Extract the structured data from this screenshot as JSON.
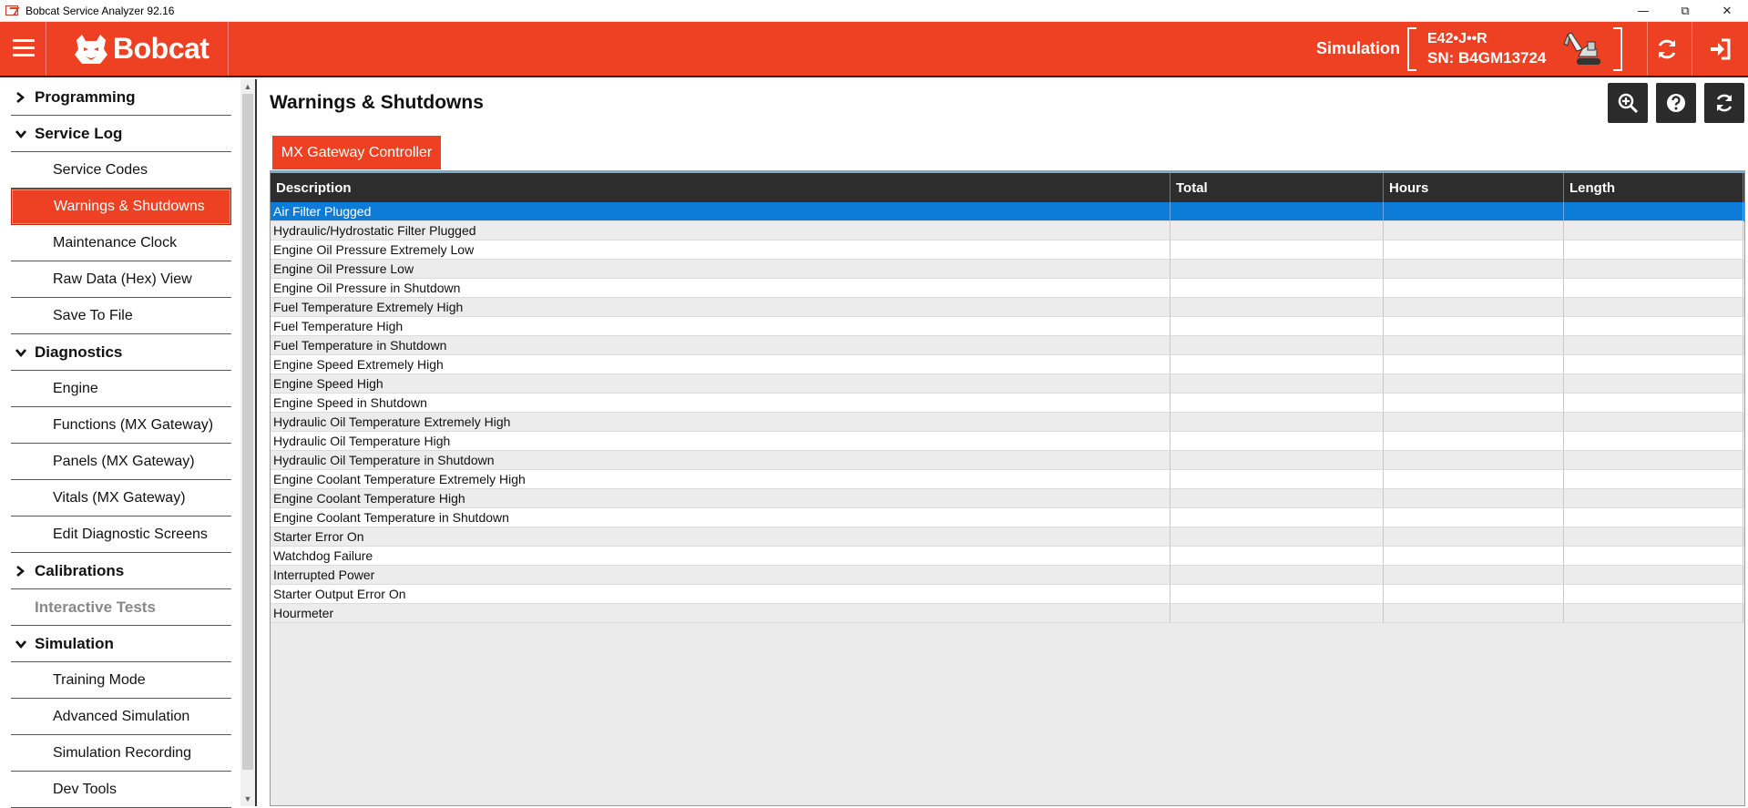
{
  "window": {
    "title": "Bobcat Service Analyzer 92.16"
  },
  "header": {
    "brand": "Bobcat",
    "mode": "Simulation",
    "model": "E42•J••R",
    "serial": "SN: B4GM13724"
  },
  "sidebar": {
    "sections": [
      {
        "label": "Programming",
        "expanded": false,
        "items": []
      },
      {
        "label": "Service Log",
        "expanded": true,
        "items": [
          "Service Codes",
          "Warnings & Shutdowns",
          "Maintenance Clock",
          "Raw Data (Hex) View",
          "Save To File"
        ]
      },
      {
        "label": "Diagnostics",
        "expanded": true,
        "items": [
          "Engine",
          "Functions (MX Gateway)",
          "Panels (MX Gateway)",
          "Vitals (MX Gateway)",
          "Edit Diagnostic Screens"
        ]
      },
      {
        "label": "Calibrations",
        "expanded": false,
        "items": []
      },
      {
        "label": "Interactive Tests",
        "disabled": true,
        "items": []
      },
      {
        "label": "Simulation",
        "expanded": true,
        "items": [
          "Training Mode",
          "Advanced Simulation",
          "Simulation Recording",
          "Dev Tools"
        ]
      }
    ],
    "active_item": "Warnings & Shutdowns"
  },
  "main": {
    "title": "Warnings & Shutdowns",
    "tab": "MX Gateway Controller",
    "columns": [
      "Description",
      "Total",
      "Hours",
      "Length"
    ],
    "rows": [
      "Air Filter Plugged",
      "Hydraulic/Hydrostatic Filter Plugged",
      "Engine Oil Pressure Extremely Low",
      "Engine Oil Pressure Low",
      "Engine Oil Pressure in Shutdown",
      "Fuel Temperature Extremely High",
      "Fuel Temperature High",
      "Fuel Temperature in Shutdown",
      "Engine Speed Extremely High",
      "Engine Speed High",
      "Engine Speed in Shutdown",
      "Hydraulic Oil Temperature Extremely High",
      "Hydraulic Oil Temperature High",
      "Hydraulic Oil Temperature in Shutdown",
      "Engine Coolant Temperature Extremely High",
      "Engine Coolant Temperature High",
      "Engine Coolant Temperature in Shutdown",
      "Starter Error On",
      "Watchdog Failure",
      "Interrupted Power",
      "Starter Output Error On",
      "Hourmeter"
    ],
    "selected_row": 0
  },
  "colors": {
    "brand": "#ee4023",
    "selection": "#0d7bd8",
    "header_dark": "#2d2d2d"
  }
}
